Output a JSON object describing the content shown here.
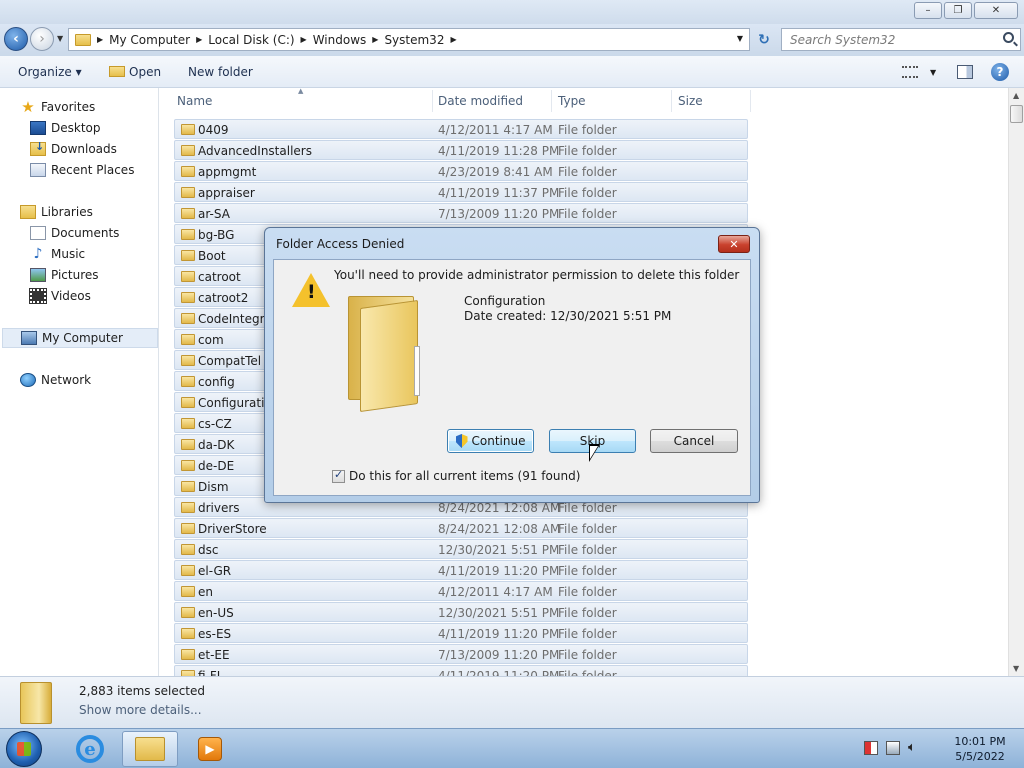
{
  "window": {
    "minimize": "–",
    "maximize": "❐",
    "close": "✕"
  },
  "address": {
    "crumbs": [
      "My Computer",
      "Local Disk (C:)",
      "Windows",
      "System32"
    ],
    "search_placeholder": "Search System32"
  },
  "toolbar": {
    "organize": "Organize ▾",
    "open": "Open",
    "new_folder": "New folder"
  },
  "nav": {
    "favorites": "Favorites",
    "desktop": "Desktop",
    "downloads": "Downloads",
    "recent": "Recent Places",
    "libraries": "Libraries",
    "documents": "Documents",
    "music": "Music",
    "pictures": "Pictures",
    "videos": "Videos",
    "computer": "My Computer",
    "network": "Network"
  },
  "columns": {
    "name": "Name",
    "date": "Date modified",
    "type": "Type",
    "size": "Size"
  },
  "files": [
    {
      "name": "0409",
      "date": "4/12/2011 4:17 AM",
      "type": "File folder"
    },
    {
      "name": "AdvancedInstallers",
      "date": "4/11/2019 11:28 PM",
      "type": "File folder"
    },
    {
      "name": "appmgmt",
      "date": "4/23/2019 8:41 AM",
      "type": "File folder"
    },
    {
      "name": "appraiser",
      "date": "4/11/2019 11:37 PM",
      "type": "File folder"
    },
    {
      "name": "ar-SA",
      "date": "7/13/2009 11:20 PM",
      "type": "File folder"
    },
    {
      "name": "bg-BG",
      "date": "",
      "type": ""
    },
    {
      "name": "Boot",
      "date": "",
      "type": ""
    },
    {
      "name": "catroot",
      "date": "",
      "type": ""
    },
    {
      "name": "catroot2",
      "date": "",
      "type": ""
    },
    {
      "name": "CodeIntegrit",
      "date": "",
      "type": ""
    },
    {
      "name": "com",
      "date": "",
      "type": ""
    },
    {
      "name": "CompatTel",
      "date": "",
      "type": ""
    },
    {
      "name": "config",
      "date": "",
      "type": ""
    },
    {
      "name": "Configuratio",
      "date": "",
      "type": ""
    },
    {
      "name": "cs-CZ",
      "date": "",
      "type": ""
    },
    {
      "name": "da-DK",
      "date": "",
      "type": ""
    },
    {
      "name": "de-DE",
      "date": "",
      "type": ""
    },
    {
      "name": "Dism",
      "date": "",
      "type": ""
    },
    {
      "name": "drivers",
      "date": "8/24/2021 12:08 AM",
      "type": "File folder"
    },
    {
      "name": "DriverStore",
      "date": "8/24/2021 12:08 AM",
      "type": "File folder"
    },
    {
      "name": "dsc",
      "date": "12/30/2021 5:51 PM",
      "type": "File folder"
    },
    {
      "name": "el-GR",
      "date": "4/11/2019 11:20 PM",
      "type": "File folder"
    },
    {
      "name": "en",
      "date": "4/12/2011 4:17 AM",
      "type": "File folder"
    },
    {
      "name": "en-US",
      "date": "12/30/2021 5:51 PM",
      "type": "File folder"
    },
    {
      "name": "es-ES",
      "date": "4/11/2019 11:20 PM",
      "type": "File folder"
    },
    {
      "name": "et-EE",
      "date": "7/13/2009 11:20 PM",
      "type": "File folder"
    },
    {
      "name": "fi-FI",
      "date": "4/11/2019 11:20 PM",
      "type": "File folder"
    }
  ],
  "details": {
    "count": "2,883 items selected",
    "more": "Show more details..."
  },
  "dialog": {
    "title": "Folder Access Denied",
    "message": "You'll need to provide administrator permission to delete this folder",
    "folder_name": "Configuration",
    "date_created": "Date created: 12/30/2021 5:51 PM",
    "continue": "Continue",
    "skip": "Skip",
    "cancel": "Cancel",
    "checkbox": "Do this for all current items (91 found)",
    "checkbox_checked": true
  },
  "taskbar": {
    "time": "10:01 PM",
    "date": "5/5/2022"
  },
  "icons": [
    "back-icon",
    "forward-icon",
    "folder-icon",
    "refresh-icon",
    "search-icon",
    "views-icon",
    "preview-pane-icon",
    "help-icon",
    "warning-icon",
    "uac-shield-icon"
  ]
}
